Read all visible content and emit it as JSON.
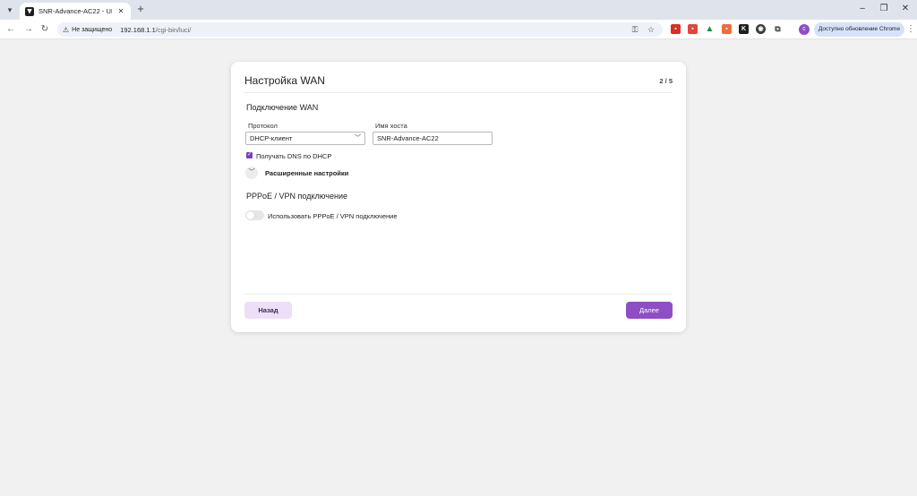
{
  "browser": {
    "tab": {
      "title": "SNR-Advance-AC22 - UI"
    },
    "address": {
      "security_label": "Не защищено",
      "host": "192.168.1.1",
      "path": "/cgi-bin/luci/"
    },
    "update_button": "Доступно обновление Chrome",
    "profile_initial": "c",
    "extensions": [
      "pdf-icon",
      "red-icon",
      "drive-icon",
      "orange-icon",
      "k-icon",
      "shield-icon",
      "puzzle-icon"
    ]
  },
  "wizard": {
    "title": "Настройка WAN",
    "step": "2 / 5",
    "wan_section": {
      "title": "Подключение WAN",
      "protocol_label": "Протокол",
      "protocol_value": "DHCP-клиент",
      "hostname_label": "Имя хоста",
      "hostname_value": "SNR-Advance-AC22",
      "dns_checkbox_label": "Получать DNS по DHCP",
      "dns_checked": true,
      "advanced_label": "Расширенные настройки"
    },
    "vpn_section": {
      "title": "PPPoE / VPN подключение",
      "toggle_label": "Использовать PPPoE / VPN подключение",
      "toggle_on": false
    },
    "buttons": {
      "back": "Назад",
      "next": "Далее"
    }
  },
  "colors": {
    "accent": "#8e4fc4",
    "accent_light": "#ecdff7",
    "page_bg": "#f1f1f1"
  }
}
